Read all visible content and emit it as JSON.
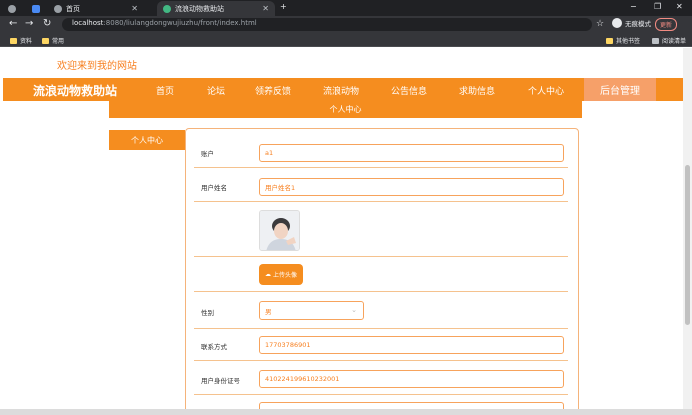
{
  "browser": {
    "tabs": [
      {
        "label": ""
      },
      {
        "label": ""
      },
      {
        "label": "首页"
      },
      {
        "label": "流浪动物救助站"
      }
    ],
    "url_host": "localhost",
    "url_path": ":8080/liulangdongwujiuzhu/front/index.html",
    "profile_label": "无痕模式",
    "update_label": "更新",
    "bookmarks": [
      {
        "label": "资料"
      },
      {
        "label": "常用"
      }
    ],
    "bookmarks_right": [
      {
        "label": "其他书签"
      },
      {
        "label": "阅读清单"
      }
    ]
  },
  "site": {
    "welcome": "欢迎来到我的网站",
    "brand": "流浪动物救助站",
    "nav": [
      {
        "label": "首页"
      },
      {
        "label": "论坛"
      },
      {
        "label": "领养反馈"
      },
      {
        "label": "流浪动物"
      },
      {
        "label": "公告信息"
      },
      {
        "label": "求助信息"
      },
      {
        "label": "个人中心"
      }
    ],
    "admin_label": "后台管理",
    "hero_title": "个人中心",
    "side_menu": [
      {
        "label": "个人中心"
      }
    ]
  },
  "form": {
    "account_label": "账户",
    "account_value": "a1",
    "name_label": "用户姓名",
    "name_value": "用户姓名1",
    "upload_label": "上传头像",
    "gender_label": "性别",
    "gender_value": "男",
    "phone_label": "联系方式",
    "phone_value": "17703786901",
    "id_label": "用户身份证号",
    "id_value": "410224199610232001"
  },
  "colors": {
    "accent": "#f58d1f",
    "accent_light": "#f6a069",
    "text_orange": "#f77f1f"
  }
}
